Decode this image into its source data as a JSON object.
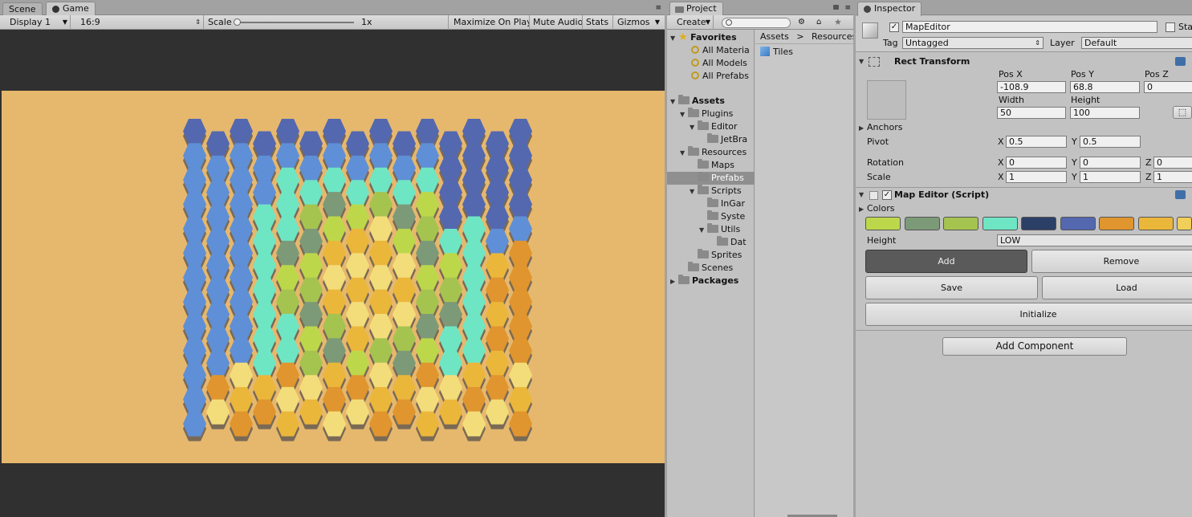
{
  "game_panel": {
    "tabs": [
      {
        "label": "Scene"
      },
      {
        "label": "Game"
      }
    ],
    "toolbar": {
      "display": "Display 1",
      "aspect": "16:9",
      "scale_label": "Scale",
      "scale_value": "1x",
      "maximize": "Maximize On Play",
      "mute": "Mute Audio",
      "stats": "Stats",
      "gizmos": "Gizmos"
    },
    "colors": {
      "letterbox": "#303030",
      "background": "#e6b86e"
    }
  },
  "project_panel": {
    "tab": "Project",
    "create": "Create",
    "breadcrumb": [
      "Assets",
      "Resources"
    ],
    "favorites": {
      "label": "Favorites",
      "items": [
        "All Materia",
        "All Models",
        "All Prefabs"
      ]
    },
    "assets": {
      "label": "Assets",
      "items": [
        {
          "label": "Plugins",
          "depth": 1
        },
        {
          "label": "Editor",
          "depth": 2
        },
        {
          "label": "JetBra",
          "depth": 3
        },
        {
          "label": "Resources",
          "depth": 1
        },
        {
          "label": "Maps",
          "depth": 2
        },
        {
          "label": "Prefabs",
          "depth": 2,
          "selected": true
        },
        {
          "label": "Scripts",
          "depth": 2
        },
        {
          "label": "InGar",
          "depth": 3
        },
        {
          "label": "Syste",
          "depth": 3
        },
        {
          "label": "Utils",
          "depth": 3
        },
        {
          "label": "Dat",
          "depth": 4
        },
        {
          "label": "Sprites",
          "depth": 2
        },
        {
          "label": "Scenes",
          "depth": 1
        }
      ]
    },
    "packages": "Packages",
    "contents": [
      "Tiles"
    ]
  },
  "inspector": {
    "tab": "Inspector",
    "object_name": "MapEditor",
    "static_label": "Stat",
    "tag_label": "Tag",
    "tag_value": "Untagged",
    "layer_label": "Layer",
    "layer_value": "Default",
    "rect_transform": {
      "title": "Rect Transform",
      "pos_x_label": "Pos X",
      "pos_x": "-108.9",
      "pos_y_label": "Pos Y",
      "pos_y": "68.8",
      "pos_z_label": "Pos Z",
      "pos_z": "0",
      "width_label": "Width",
      "width": "50",
      "height_label": "Height",
      "height": "100",
      "anchors": "Anchors",
      "pivot_label": "Pivot",
      "pivot_x": "0.5",
      "pivot_y": "0.5",
      "rotation_label": "Rotation",
      "rot_x": "0",
      "rot_y": "0",
      "rot_z": "0",
      "scale_label": "Scale",
      "scale_x": "1",
      "scale_y": "1",
      "scale_z": "1",
      "x": "X",
      "y": "Y",
      "z": "Z"
    },
    "map_editor": {
      "title": "Map Editor (Script)",
      "colors_label": "Colors",
      "swatches": [
        "#bcd84a",
        "#7d9a78",
        "#a5c44f",
        "#6ee6c4",
        "#2c3f66",
        "#5468b0",
        "#e0952e",
        "#ebb73a",
        "#f0cf5a"
      ],
      "height_label": "Height",
      "height_value": "LOW",
      "add": "Add",
      "remove": "Remove",
      "save": "Save",
      "load": "Load",
      "initialize": "Initialize"
    },
    "add_component": "Add Component"
  }
}
